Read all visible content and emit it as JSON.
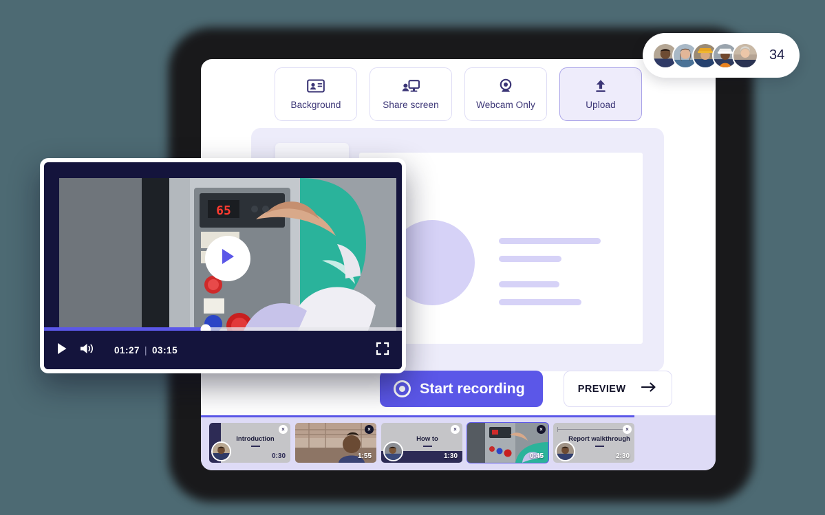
{
  "toolbar": {
    "buttons": [
      {
        "label": "Background",
        "icon": "id-card-icon",
        "active": false
      },
      {
        "label": "Share screen",
        "icon": "share-screen-icon",
        "active": false
      },
      {
        "label": "Webcam Only",
        "icon": "webcam-icon",
        "active": false
      },
      {
        "label": "Upload",
        "icon": "upload-icon",
        "active": true
      }
    ]
  },
  "actions": {
    "record_label": "Start recording",
    "record_icon": "record-dot-icon",
    "preview_label": "PREVIEW",
    "preview_icon": "arrow-right-icon"
  },
  "player": {
    "current_time": "01:27",
    "separator": "|",
    "total_time": "03:15",
    "progress_percent": 45,
    "play_icon": "play-icon",
    "volume_icon": "volume-icon",
    "fullscreen_icon": "fullscreen-icon",
    "overlay_play_icon": "play-icon"
  },
  "timeline": {
    "progress_percent": 84,
    "clips": [
      {
        "title": "Introduction",
        "duration": "0:30",
        "kind": "titled",
        "selected": false,
        "close_filled": false
      },
      {
        "title": "",
        "duration": "1:55",
        "kind": "photo-warehouse",
        "selected": false,
        "close_filled": true
      },
      {
        "title": "How to",
        "duration": "1:30",
        "kind": "titled-dark",
        "selected": false,
        "close_filled": false
      },
      {
        "title": "",
        "duration": "0:45",
        "kind": "photo-machine",
        "selected": true,
        "close_filled": true
      },
      {
        "title": "Report walkthrough",
        "duration": "2:30",
        "kind": "titled-ruler",
        "selected": false,
        "close_filled": false
      }
    ],
    "close_label": "×"
  },
  "participants": {
    "count": "34",
    "avatars": [
      "avatar-worker-1",
      "avatar-worker-2",
      "avatar-worker-3",
      "avatar-worker-4",
      "avatar-worker-5"
    ]
  },
  "colors": {
    "page_background": "#4d6a73",
    "accent": "#5b57e8",
    "panel": "#ffffff",
    "canvas": "#edecfa",
    "timeline": "#dedbf6",
    "player_chrome": "#14143c",
    "text_dark": "#14142b",
    "text_purple": "#3b3576"
  }
}
